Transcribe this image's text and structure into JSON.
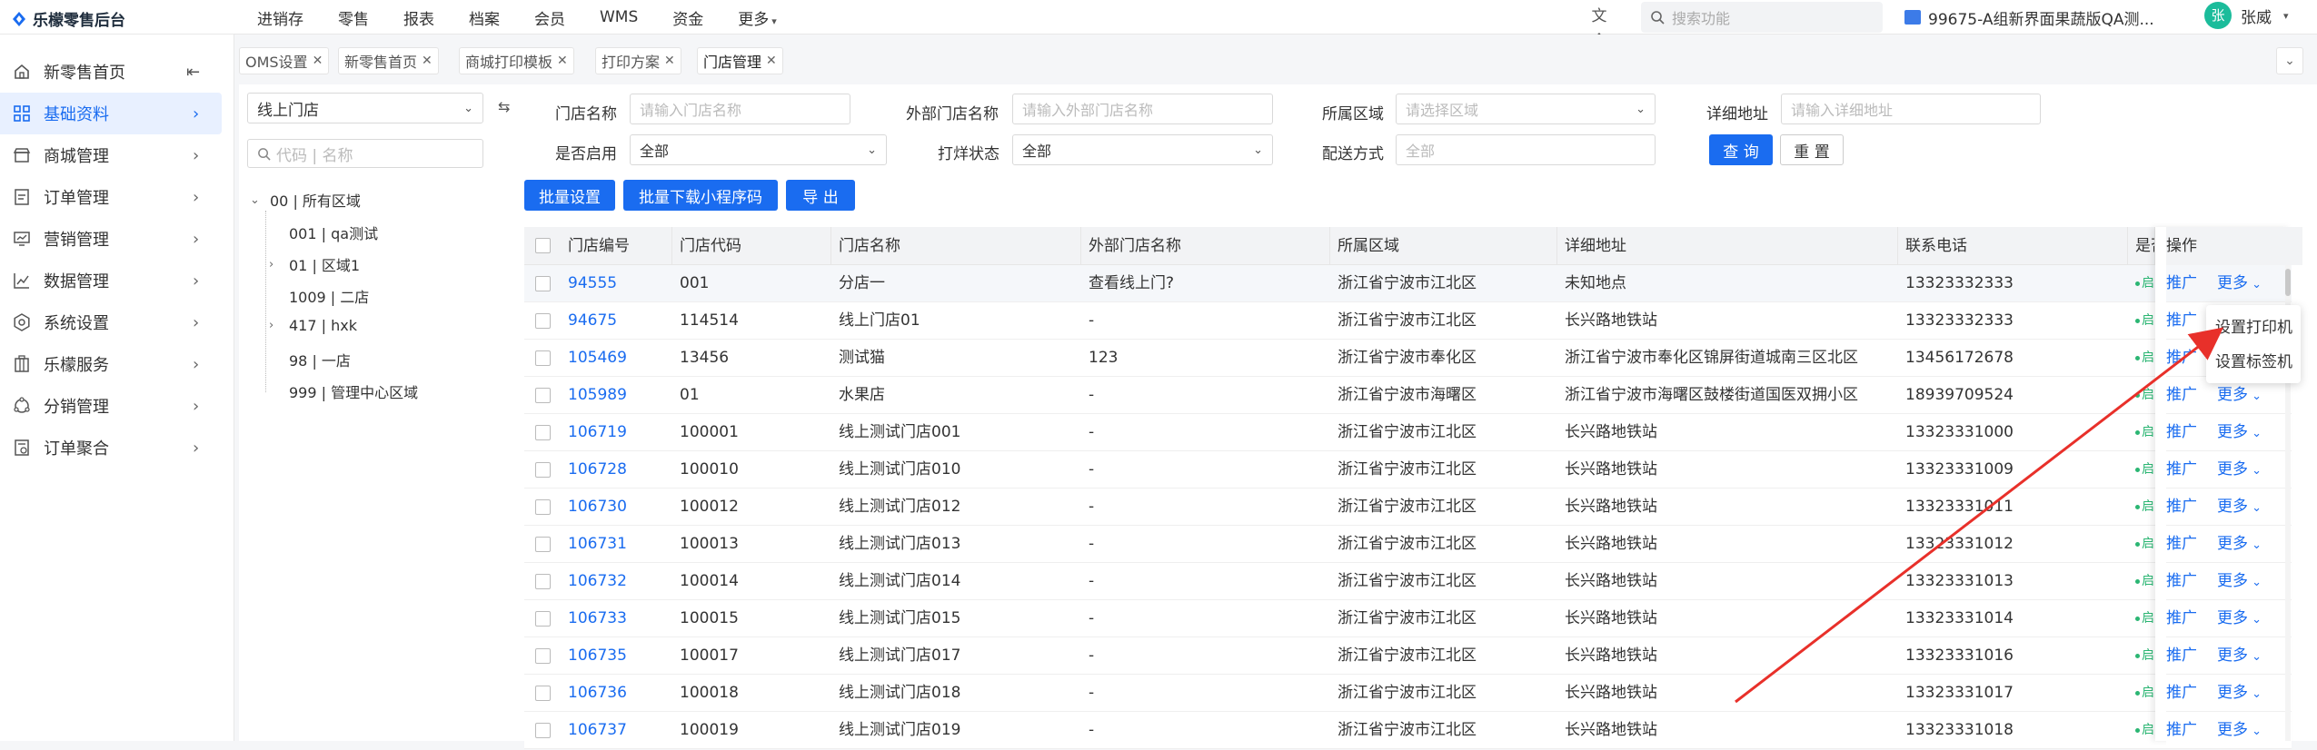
{
  "app": {
    "title": "乐檬零售后台"
  },
  "topnav": {
    "items": [
      "进销存",
      "零售",
      "报表",
      "档案",
      "会员",
      "WMS",
      "资金"
    ],
    "more": "更多"
  },
  "search": {
    "placeholder": "搜索功能"
  },
  "store": {
    "name": "99675-A组新界面果蔬版QA测..."
  },
  "user": {
    "avatar": "张",
    "name": "张威"
  },
  "sidebar": {
    "items": [
      {
        "label": "新零售首页",
        "icon": "home-icon"
      },
      {
        "label": "基础资料",
        "icon": "grid-icon",
        "active": true
      },
      {
        "label": "商城管理",
        "icon": "shop-icon"
      },
      {
        "label": "订单管理",
        "icon": "order-icon"
      },
      {
        "label": "营销管理",
        "icon": "marketing-icon"
      },
      {
        "label": "数据管理",
        "icon": "chart-icon"
      },
      {
        "label": "系统设置",
        "icon": "gear-icon"
      },
      {
        "label": "乐檬服务",
        "icon": "building-icon"
      },
      {
        "label": "分销管理",
        "icon": "distribution-icon"
      },
      {
        "label": "订单聚合",
        "icon": "aggregate-icon"
      }
    ]
  },
  "tabs": [
    "OMS设置",
    "新零售首页",
    "商城打印模板",
    "打印方案",
    "门店管理"
  ],
  "left": {
    "type_select": "线上门店",
    "search_placeholder": "代码 | 名称",
    "tree": [
      "00 | 所有区域",
      "001 | qa测试",
      "01 | 区域1",
      "1009 | 二店",
      "417 | hxk",
      "98 | 一店",
      "999 | 管理中心区域"
    ]
  },
  "filters": {
    "store_name": {
      "label": "门店名称",
      "placeholder": "请输入门店名称"
    },
    "ext_name": {
      "label": "外部门店名称",
      "placeholder": "请输入外部门店名称"
    },
    "region": {
      "label": "所属区域",
      "placeholder": "请选择区域"
    },
    "address": {
      "label": "详细地址",
      "placeholder": "请输入详细地址"
    },
    "enabled": {
      "label": "是否启用",
      "value": "全部"
    },
    "status": {
      "label": "打烊状态",
      "value": "全部"
    },
    "delivery": {
      "label": "配送方式",
      "placeholder": "全部"
    },
    "query": "查 询",
    "reset": "重 置"
  },
  "actions": {
    "batch_set": "批量设置",
    "batch_download": "批量下载小程序码",
    "export": "导 出"
  },
  "table": {
    "headers": [
      "门店编号",
      "门店代码",
      "门店名称",
      "外部门店名称",
      "所属区域",
      "详细地址",
      "联系电话",
      "是否",
      "操作"
    ],
    "rows": [
      [
        "94555",
        "001",
        "分店一",
        "查看线上门?",
        "浙江省宁波市江北区",
        "未知地点",
        "13323332333"
      ],
      [
        "94675",
        "114514",
        "线上门店01",
        "-",
        "浙江省宁波市江北区",
        "长兴路地铁站",
        "13323332333"
      ],
      [
        "105469",
        "13456",
        "测试猫",
        "123",
        "浙江省宁波市奉化区",
        "浙江省宁波市奉化区锦屏街道城南三区北区",
        "13456172678"
      ],
      [
        "105989",
        "01",
        "水果店",
        "-",
        "浙江省宁波市海曙区",
        "浙江省宁波市海曙区鼓楼街道国医双拥小区",
        "18939709524"
      ],
      [
        "106719",
        "100001",
        "线上测试门店001",
        "-",
        "浙江省宁波市江北区",
        "长兴路地铁站",
        "13323331000"
      ],
      [
        "106728",
        "100010",
        "线上测试门店010",
        "-",
        "浙江省宁波市江北区",
        "长兴路地铁站",
        "13323331009"
      ],
      [
        "106730",
        "100012",
        "线上测试门店012",
        "-",
        "浙江省宁波市江北区",
        "长兴路地铁站",
        "13323331011"
      ],
      [
        "106731",
        "100013",
        "线上测试门店013",
        "-",
        "浙江省宁波市江北区",
        "长兴路地铁站",
        "13323331012"
      ],
      [
        "106732",
        "100014",
        "线上测试门店014",
        "-",
        "浙江省宁波市江北区",
        "长兴路地铁站",
        "13323331013"
      ],
      [
        "106733",
        "100015",
        "线上测试门店015",
        "-",
        "浙江省宁波市江北区",
        "长兴路地铁站",
        "13323331014"
      ],
      [
        "106735",
        "100017",
        "线上测试门店017",
        "-",
        "浙江省宁波市江北区",
        "长兴路地铁站",
        "13323331016"
      ],
      [
        "106736",
        "100018",
        "线上测试门店018",
        "-",
        "浙江省宁波市江北区",
        "长兴路地铁站",
        "13323331017"
      ],
      [
        "106737",
        "100019",
        "线上测试门店019",
        "-",
        "浙江省宁波市江北区",
        "长兴路地铁站",
        "13323331018"
      ]
    ],
    "status_char": "启",
    "op_promote": "推广",
    "op_more": "更多"
  },
  "dropdown": {
    "items": [
      "设置打印机",
      "设置标签机"
    ]
  },
  "colors": {
    "accent": "#1a6cf0",
    "annotation": "#e8302a"
  }
}
